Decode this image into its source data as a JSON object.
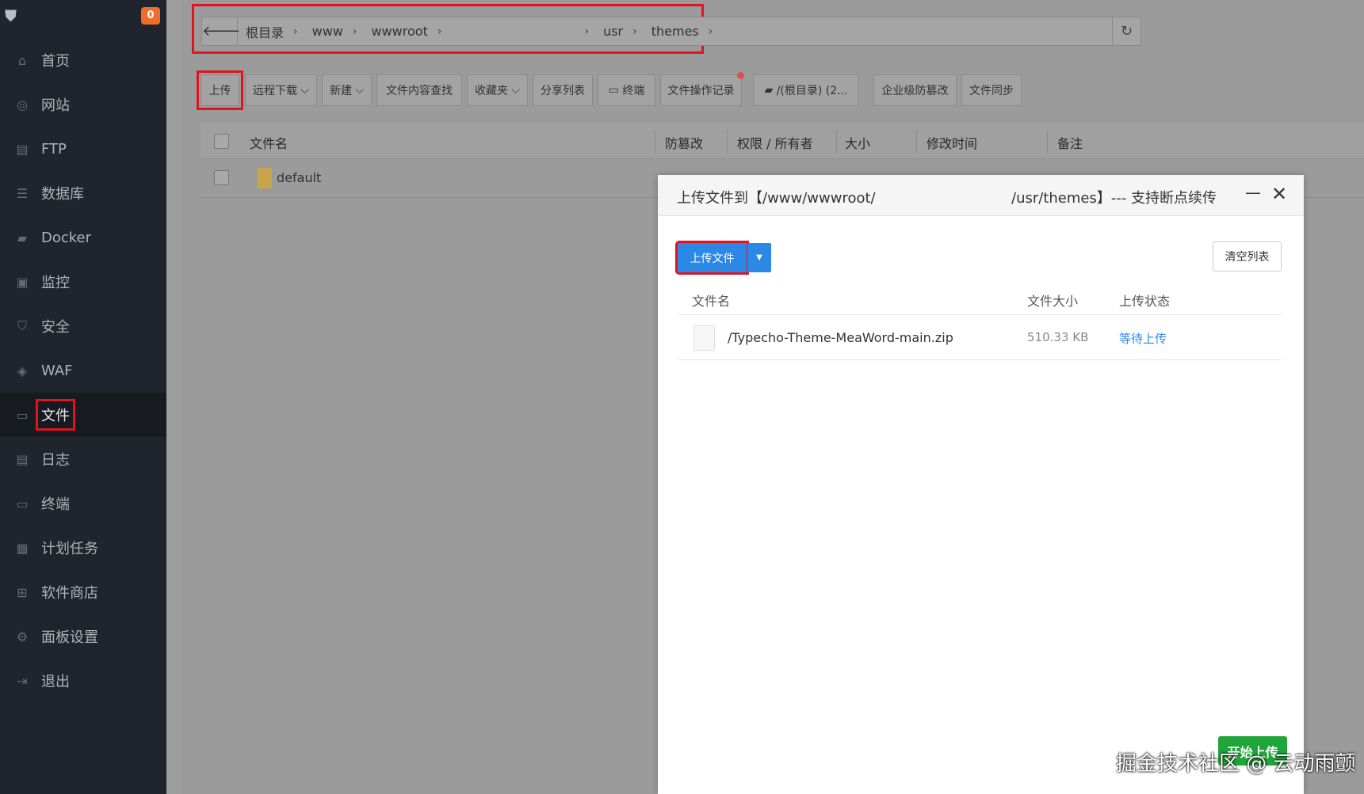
{
  "sidebar": {
    "notif_count": "0",
    "items": [
      {
        "label": "首页",
        "icon": "home-icon",
        "glyph": "⌂"
      },
      {
        "label": "网站",
        "icon": "globe-icon",
        "glyph": "◎"
      },
      {
        "label": "FTP",
        "icon": "ftp-icon",
        "glyph": "▤"
      },
      {
        "label": "数据库",
        "icon": "database-icon",
        "glyph": "☰"
      },
      {
        "label": "Docker",
        "icon": "docker-icon",
        "glyph": "▰"
      },
      {
        "label": "监控",
        "icon": "monitor-icon",
        "glyph": "▣"
      },
      {
        "label": "安全",
        "icon": "shield-icon",
        "glyph": "⛉"
      },
      {
        "label": "WAF",
        "icon": "waf-icon",
        "glyph": "◈"
      },
      {
        "label": "文件",
        "icon": "folder-icon",
        "glyph": "▭"
      },
      {
        "label": "日志",
        "icon": "log-icon",
        "glyph": "▤"
      },
      {
        "label": "终端",
        "icon": "terminal-icon",
        "glyph": "▭"
      },
      {
        "label": "计划任务",
        "icon": "calendar-icon",
        "glyph": "▦"
      },
      {
        "label": "软件商店",
        "icon": "apps-icon",
        "glyph": "⊞"
      },
      {
        "label": "面板设置",
        "icon": "gear-icon",
        "glyph": "⚙"
      },
      {
        "label": "退出",
        "icon": "logout-icon",
        "glyph": "⇥"
      }
    ]
  },
  "path": {
    "crumbs": [
      "根目录",
      "www",
      "wwwroot",
      "",
      "usr",
      "themes"
    ]
  },
  "toolbar": {
    "upload": "上传",
    "remote_download": "远程下载",
    "new": "新建",
    "content_search": "文件内容查找",
    "favorites": "收藏夹",
    "share_list": "分享列表",
    "terminal": "终端",
    "op_log": "文件操作记录",
    "disk": "/(根目录) (2...",
    "enterprise_tamper": "企业级防篡改",
    "file_sync": "文件同步"
  },
  "table": {
    "headers": [
      "文件名",
      "防篡改",
      "权限 / 所有者",
      "大小",
      "修改时间",
      "备注"
    ],
    "rows": [
      {
        "name": "default"
      }
    ]
  },
  "dialog": {
    "title_left": "上传文件到【/www/wwwroot/",
    "title_right": "/usr/themes】--- 支持断点续传",
    "upload_btn": "上传文件",
    "clear_btn": "清空列表",
    "headers": [
      "文件名",
      "文件大小",
      "上传状态"
    ],
    "files": [
      {
        "name": "/Typecho-Theme-MeaWord-main.zip",
        "size": "510.33 KB",
        "status": "等待上传"
      }
    ],
    "start_btn": "开始上传",
    "status_color": "#2b88e6"
  },
  "watermark": "掘金技术社区 @ 云动雨颤"
}
